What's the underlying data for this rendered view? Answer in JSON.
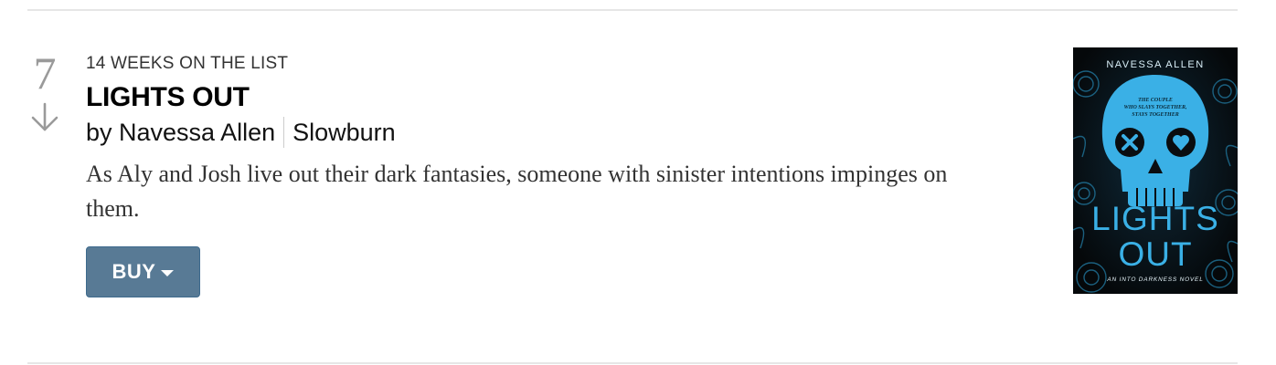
{
  "entry": {
    "rank": "7",
    "weeks_on_list": "14 WEEKS ON THE LIST",
    "title": "LIGHTS OUT",
    "byline": "by Navessa Allen",
    "publisher": "Slowburn",
    "description": "As Aly and Josh live out their dark fantasies, someone with sinister intentions impinges on them.",
    "trend_icon": "arrow-down-icon",
    "buy_label": "BUY"
  },
  "cover": {
    "author": "NAVESSA ALLEN",
    "tagline_1": "THE COUPLE",
    "tagline_2": "WHO SLAYS TOGETHER,",
    "tagline_3": "STAYS TOGETHER",
    "title_line_1": "LIGHTS",
    "title_line_2": "OUT",
    "series": "AN INTO DARKNESS NOVEL",
    "accent_color": "#3ab0e6"
  },
  "colors": {
    "button_bg": "#587a95",
    "button_border": "#3e6a8d",
    "rank_gray": "#9a9a9a",
    "divider": "#e6e6e6"
  }
}
